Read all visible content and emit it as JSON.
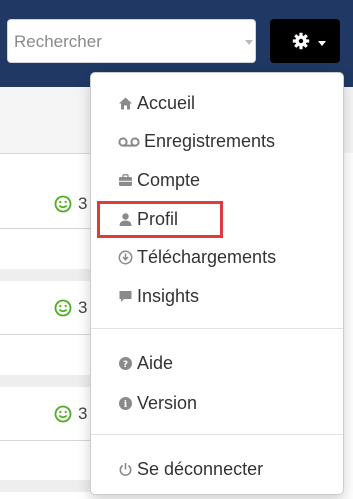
{
  "search": {
    "placeholder": "Rechercher"
  },
  "settings_button": {
    "icon": "gear-icon"
  },
  "rows": [
    {
      "value": "3"
    },
    {
      "value": "3"
    },
    {
      "value": "3"
    }
  ],
  "menu": {
    "items": [
      {
        "label": "Accueil",
        "icon": "home-icon"
      },
      {
        "label": "Enregistrements",
        "icon": "voicemail-icon"
      },
      {
        "label": "Compte",
        "icon": "briefcase-icon"
      },
      {
        "label": "Profil",
        "icon": "user-icon"
      },
      {
        "label": "Téléchargements",
        "icon": "download-icon"
      },
      {
        "label": "Insights",
        "icon": "comment-icon"
      },
      {
        "label": "Aide",
        "icon": "help-icon"
      },
      {
        "label": "Version",
        "icon": "info-icon"
      },
      {
        "label": "Se déconnecter",
        "icon": "power-icon"
      }
    ]
  },
  "colors": {
    "topbar": "#1f3864",
    "highlight": "#e03b3b",
    "smile": "#4caf1e"
  }
}
